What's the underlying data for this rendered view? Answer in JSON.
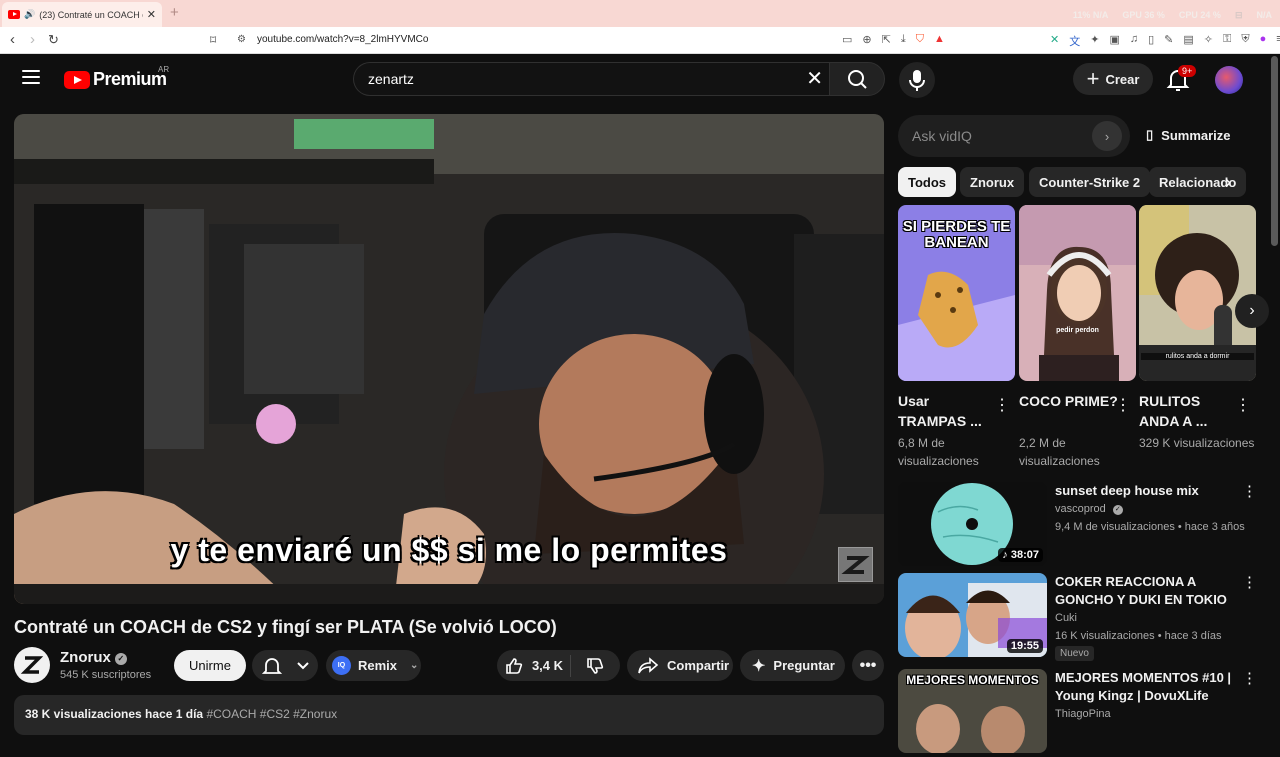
{
  "browser": {
    "tab_title": "(23) Contraté un COACH de CS2 y fingí ser PLATA (Se volvió LOCO)",
    "new_tab": "+",
    "url": "youtube.com/watch?v=8_2lmHYVMCo",
    "stats": [
      "11%  N/A",
      "GPU  36 %",
      "CPU  24 %",
      "N/A"
    ]
  },
  "header": {
    "logo_word": "Premium",
    "country": "AR",
    "search_value": "zenartz",
    "create_label": "Crear",
    "notif_badge": "9+"
  },
  "video": {
    "caption": "y te enviaré un $$ si me lo permites",
    "title": "Contraté un COACH de CS2 y fingí ser PLATA (Se volvió LOCO)",
    "channel": "Znorux",
    "subscribers": "545 K suscriptores",
    "join_label": "Unirme",
    "remix_label": "Remix",
    "likes": "3,4 K",
    "share_label": "Compartir",
    "ask_label": "Preguntar",
    "views_date": "38 K visualizaciones  hace 1 día",
    "tags": "#COACH #CS2 #Znorux"
  },
  "sidebar": {
    "vidiq_placeholder": "Ask vidIQ",
    "summarize_label": "Summarize",
    "chips": [
      "Todos",
      "Znorux",
      "Counter-Strike 2",
      "Relacionado"
    ],
    "shorts": [
      {
        "title": "Usar TRAMPAS ...",
        "views": "6,8 M de visualizaciones",
        "overlay": "SI PIERDES TE BANEAN"
      },
      {
        "title": "COCO PRIME?",
        "views": "2,2 M de visualizaciones",
        "overlay": "pedir perdon"
      },
      {
        "title": "RULITOS ANDA A ...",
        "views": "329 K visualizaciones",
        "overlay": "rulitos anda a dormir"
      }
    ],
    "recommended": [
      {
        "title": "sunset deep house mix",
        "channel": "vascoprod",
        "meta": "9,4 M de visualizaciones • hace 3 años",
        "duration": "38:07"
      },
      {
        "title": "COKER REACCIONA A GONCHO Y DUKI EN TOKIO",
        "channel": "Cuki",
        "meta": "16 K visualizaciones • hace 3 días",
        "duration": "19:55",
        "badge": "Nuevo"
      },
      {
        "title": "MEJORES MOMENTOS #10 | Young Kingz | DovuXLife",
        "channel": "ThiagoPina",
        "thumb_text": "MEJORES MOMENTOS"
      }
    ]
  },
  "colors": {
    "brand_red": "#ff0000",
    "bg": "#0f0f0f",
    "chip": "#272727"
  }
}
